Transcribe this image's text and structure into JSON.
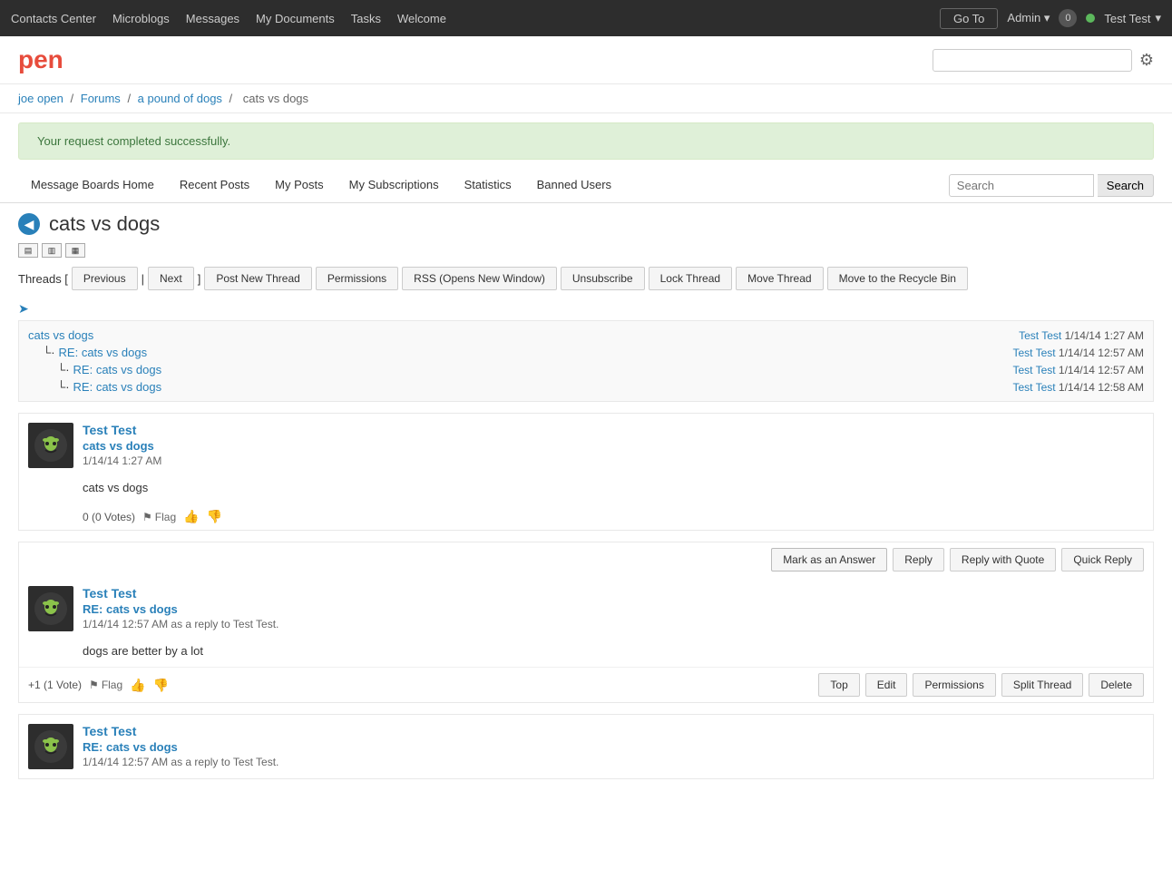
{
  "topnav": {
    "links": [
      {
        "label": "Contacts Center",
        "id": "contacts-center"
      },
      {
        "label": "Microblogs",
        "id": "microblogs"
      },
      {
        "label": "Messages",
        "id": "messages"
      },
      {
        "label": "My Documents",
        "id": "my-documents"
      },
      {
        "label": "Tasks",
        "id": "tasks"
      },
      {
        "label": "Welcome",
        "id": "welcome"
      }
    ],
    "go_to_label": "Go To",
    "admin_label": "Admin",
    "notification_count": "0",
    "user_label": "Test Test"
  },
  "site": {
    "logo": "pen"
  },
  "breadcrumb": {
    "items": [
      {
        "label": "joe open",
        "href": "#"
      },
      {
        "label": "Forums",
        "href": "#"
      },
      {
        "label": "a pound of dogs",
        "href": "#"
      },
      {
        "label": "cats vs dogs",
        "href": "#"
      }
    ]
  },
  "success_message": "Your request completed successfully.",
  "tabs": {
    "items": [
      {
        "label": "Message Boards Home"
      },
      {
        "label": "Recent Posts"
      },
      {
        "label": "My Posts"
      },
      {
        "label": "My Subscriptions"
      },
      {
        "label": "Statistics"
      },
      {
        "label": "Banned Users"
      }
    ],
    "search_placeholder": "Search",
    "search_button_label": "Search"
  },
  "thread": {
    "title": "cats vs dogs",
    "view_icons": [
      "list",
      "split",
      "grid"
    ],
    "action_bar": {
      "threads_label": "Threads [",
      "previous_label": "Previous",
      "sep1": "|",
      "next_label": "Next",
      "close_bracket": "]",
      "buttons": [
        {
          "label": "Post New Thread"
        },
        {
          "label": "Permissions"
        },
        {
          "label": "RSS (Opens New Window)"
        },
        {
          "label": "Unsubscribe"
        },
        {
          "label": "Lock Thread"
        },
        {
          "label": "Move Thread"
        },
        {
          "label": "Move to the Recycle Bin"
        }
      ]
    },
    "tree": {
      "rows": [
        {
          "indent": 0,
          "prefix": "",
          "label": "cats vs dogs",
          "author": "Test Test",
          "date": "1/14/14 1:27 AM"
        },
        {
          "indent": 1,
          "prefix": "└·",
          "label": "RE: cats vs dogs",
          "author": "Test Test",
          "date": "1/14/14 12:57 AM"
        },
        {
          "indent": 2,
          "prefix": "└·",
          "label": "RE: cats vs dogs",
          "author": "Test Test",
          "date": "1/14/14 12:57 AM"
        },
        {
          "indent": 2,
          "prefix": "└·",
          "label": "RE: cats vs dogs",
          "author": "Test Test",
          "date": "1/14/14 12:58 AM"
        }
      ]
    },
    "posts": [
      {
        "id": "post-1",
        "author": "Test Test",
        "subject": "cats vs dogs",
        "date": "1/14/14 1:27 AM",
        "body": "cats vs dogs",
        "vote_label": "0 (0 Votes)",
        "flag_label": "Flag",
        "thumbs_up": "👍",
        "thumbs_down": "👎",
        "show_reply_buttons": false,
        "show_bottom_bar": false
      },
      {
        "id": "post-2",
        "author": "Test Test",
        "subject": "RE: cats vs dogs",
        "date": "1/14/14 12:57 AM as a reply to Test Test.",
        "body": "dogs are better by a lot",
        "vote_label": "+1 (1 Vote)",
        "flag_label": "Flag",
        "thumbs_up": "👍",
        "thumbs_down": "👎",
        "show_reply_buttons": true,
        "mark_answer_label": "Mark as an Answer",
        "reply_label": "Reply",
        "reply_quote_label": "Reply with Quote",
        "quick_reply_label": "Quick Reply",
        "show_bottom_bar": true,
        "bottom_buttons": [
          {
            "label": "Top"
          },
          {
            "label": "Edit"
          },
          {
            "label": "Permissions"
          },
          {
            "label": "Split Thread"
          },
          {
            "label": "Delete"
          }
        ]
      },
      {
        "id": "post-3",
        "author": "Test Test",
        "subject": "RE: cats vs dogs",
        "date": "1/14/14 12:57 AM as a reply to Test Test.",
        "body": "",
        "vote_label": "",
        "flag_label": "",
        "show_reply_buttons": false,
        "show_bottom_bar": false,
        "partial": true
      }
    ]
  }
}
